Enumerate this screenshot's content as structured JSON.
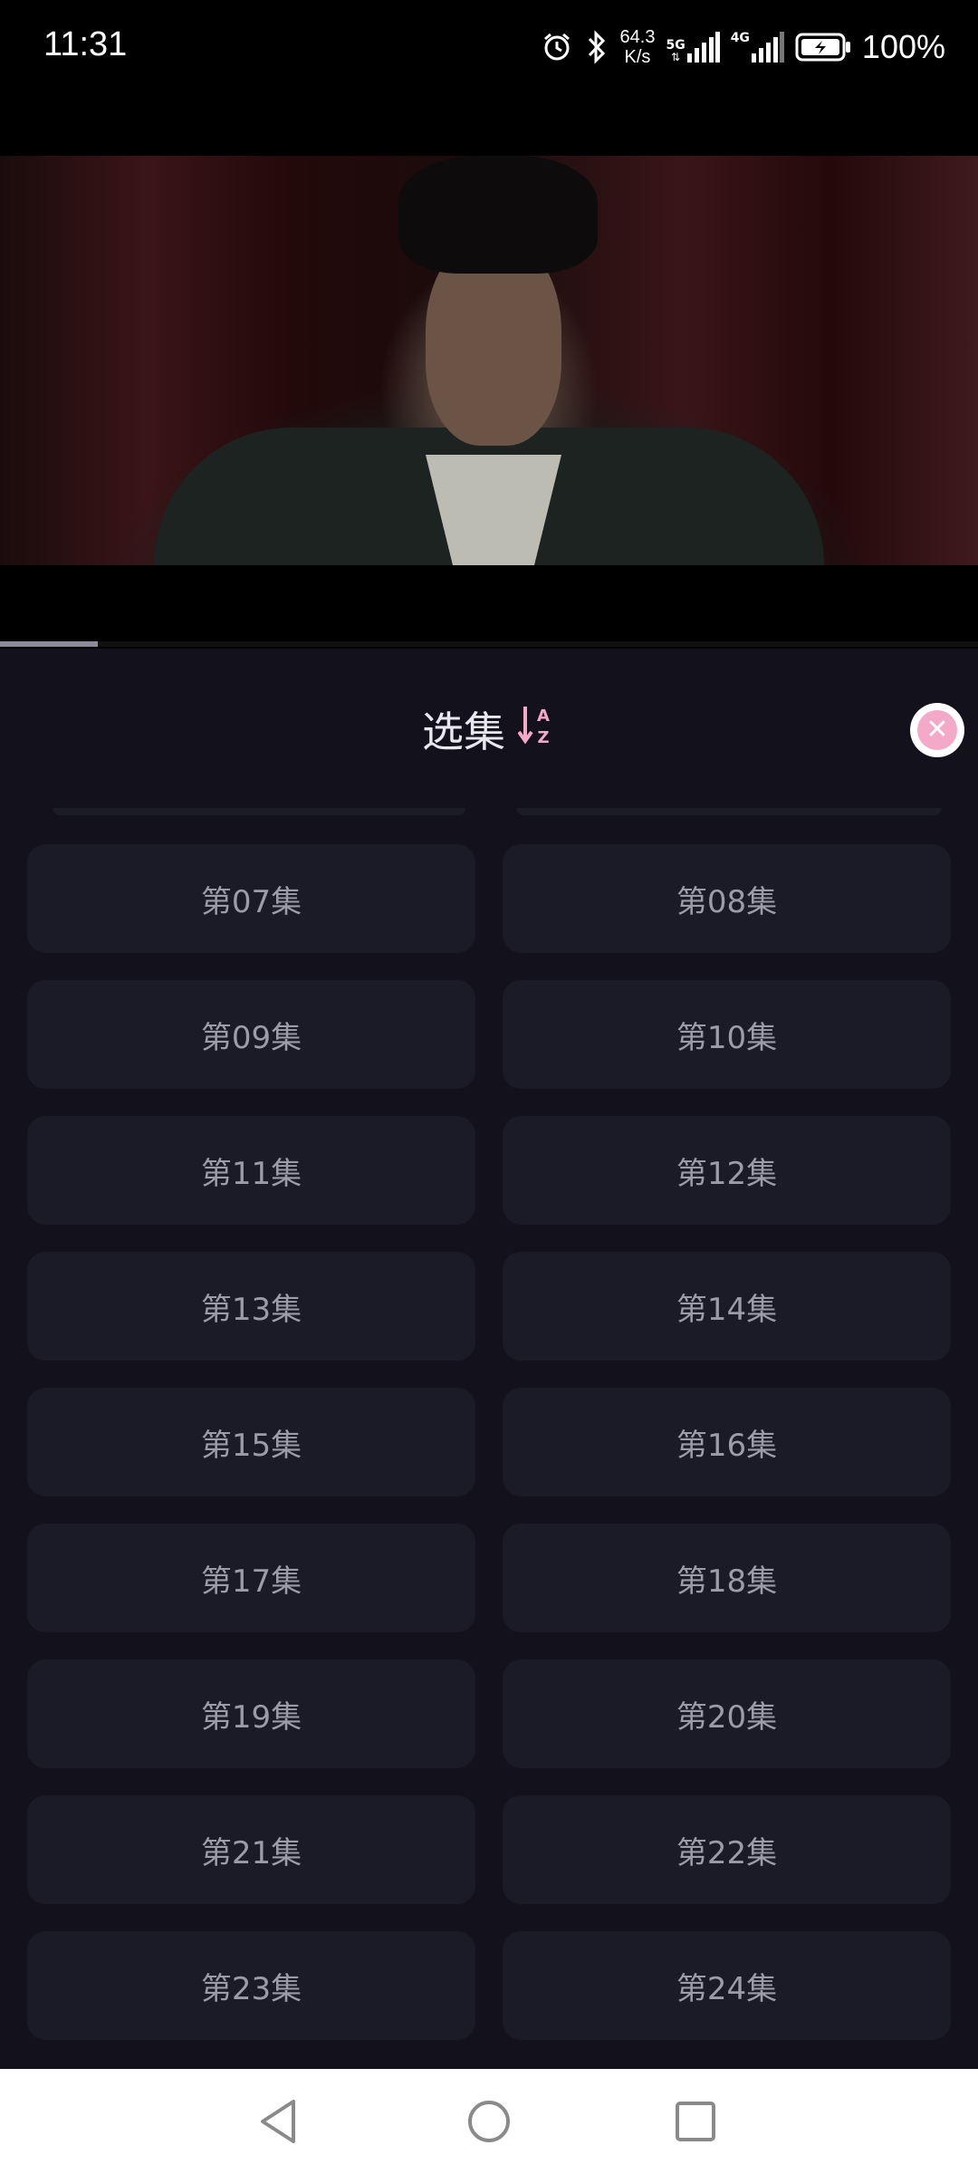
{
  "status_bar": {
    "time": "11:31",
    "net_speed_value": "64.3",
    "net_speed_unit": "K/s",
    "signal_1_label": "5G",
    "signal_2_label": "4G",
    "battery_percent": "100%",
    "icons": [
      "alarm-icon",
      "bluetooth-icon",
      "signal-icon",
      "battery-charging-icon"
    ]
  },
  "video": {
    "progress_fraction": 0.1
  },
  "episode_panel": {
    "title": "选集",
    "sort_icon": "sort-az-icon",
    "close_icon": "close-icon",
    "accent_color": "#f4a9c8",
    "episodes": [
      "第07集",
      "第08集",
      "第09集",
      "第10集",
      "第11集",
      "第12集",
      "第13集",
      "第14集",
      "第15集",
      "第16集",
      "第17集",
      "第18集",
      "第19集",
      "第20集",
      "第21集",
      "第22集",
      "第23集",
      "第24集"
    ]
  },
  "nav_bar": {
    "icons": [
      "back-icon",
      "home-icon",
      "recents-icon"
    ]
  }
}
